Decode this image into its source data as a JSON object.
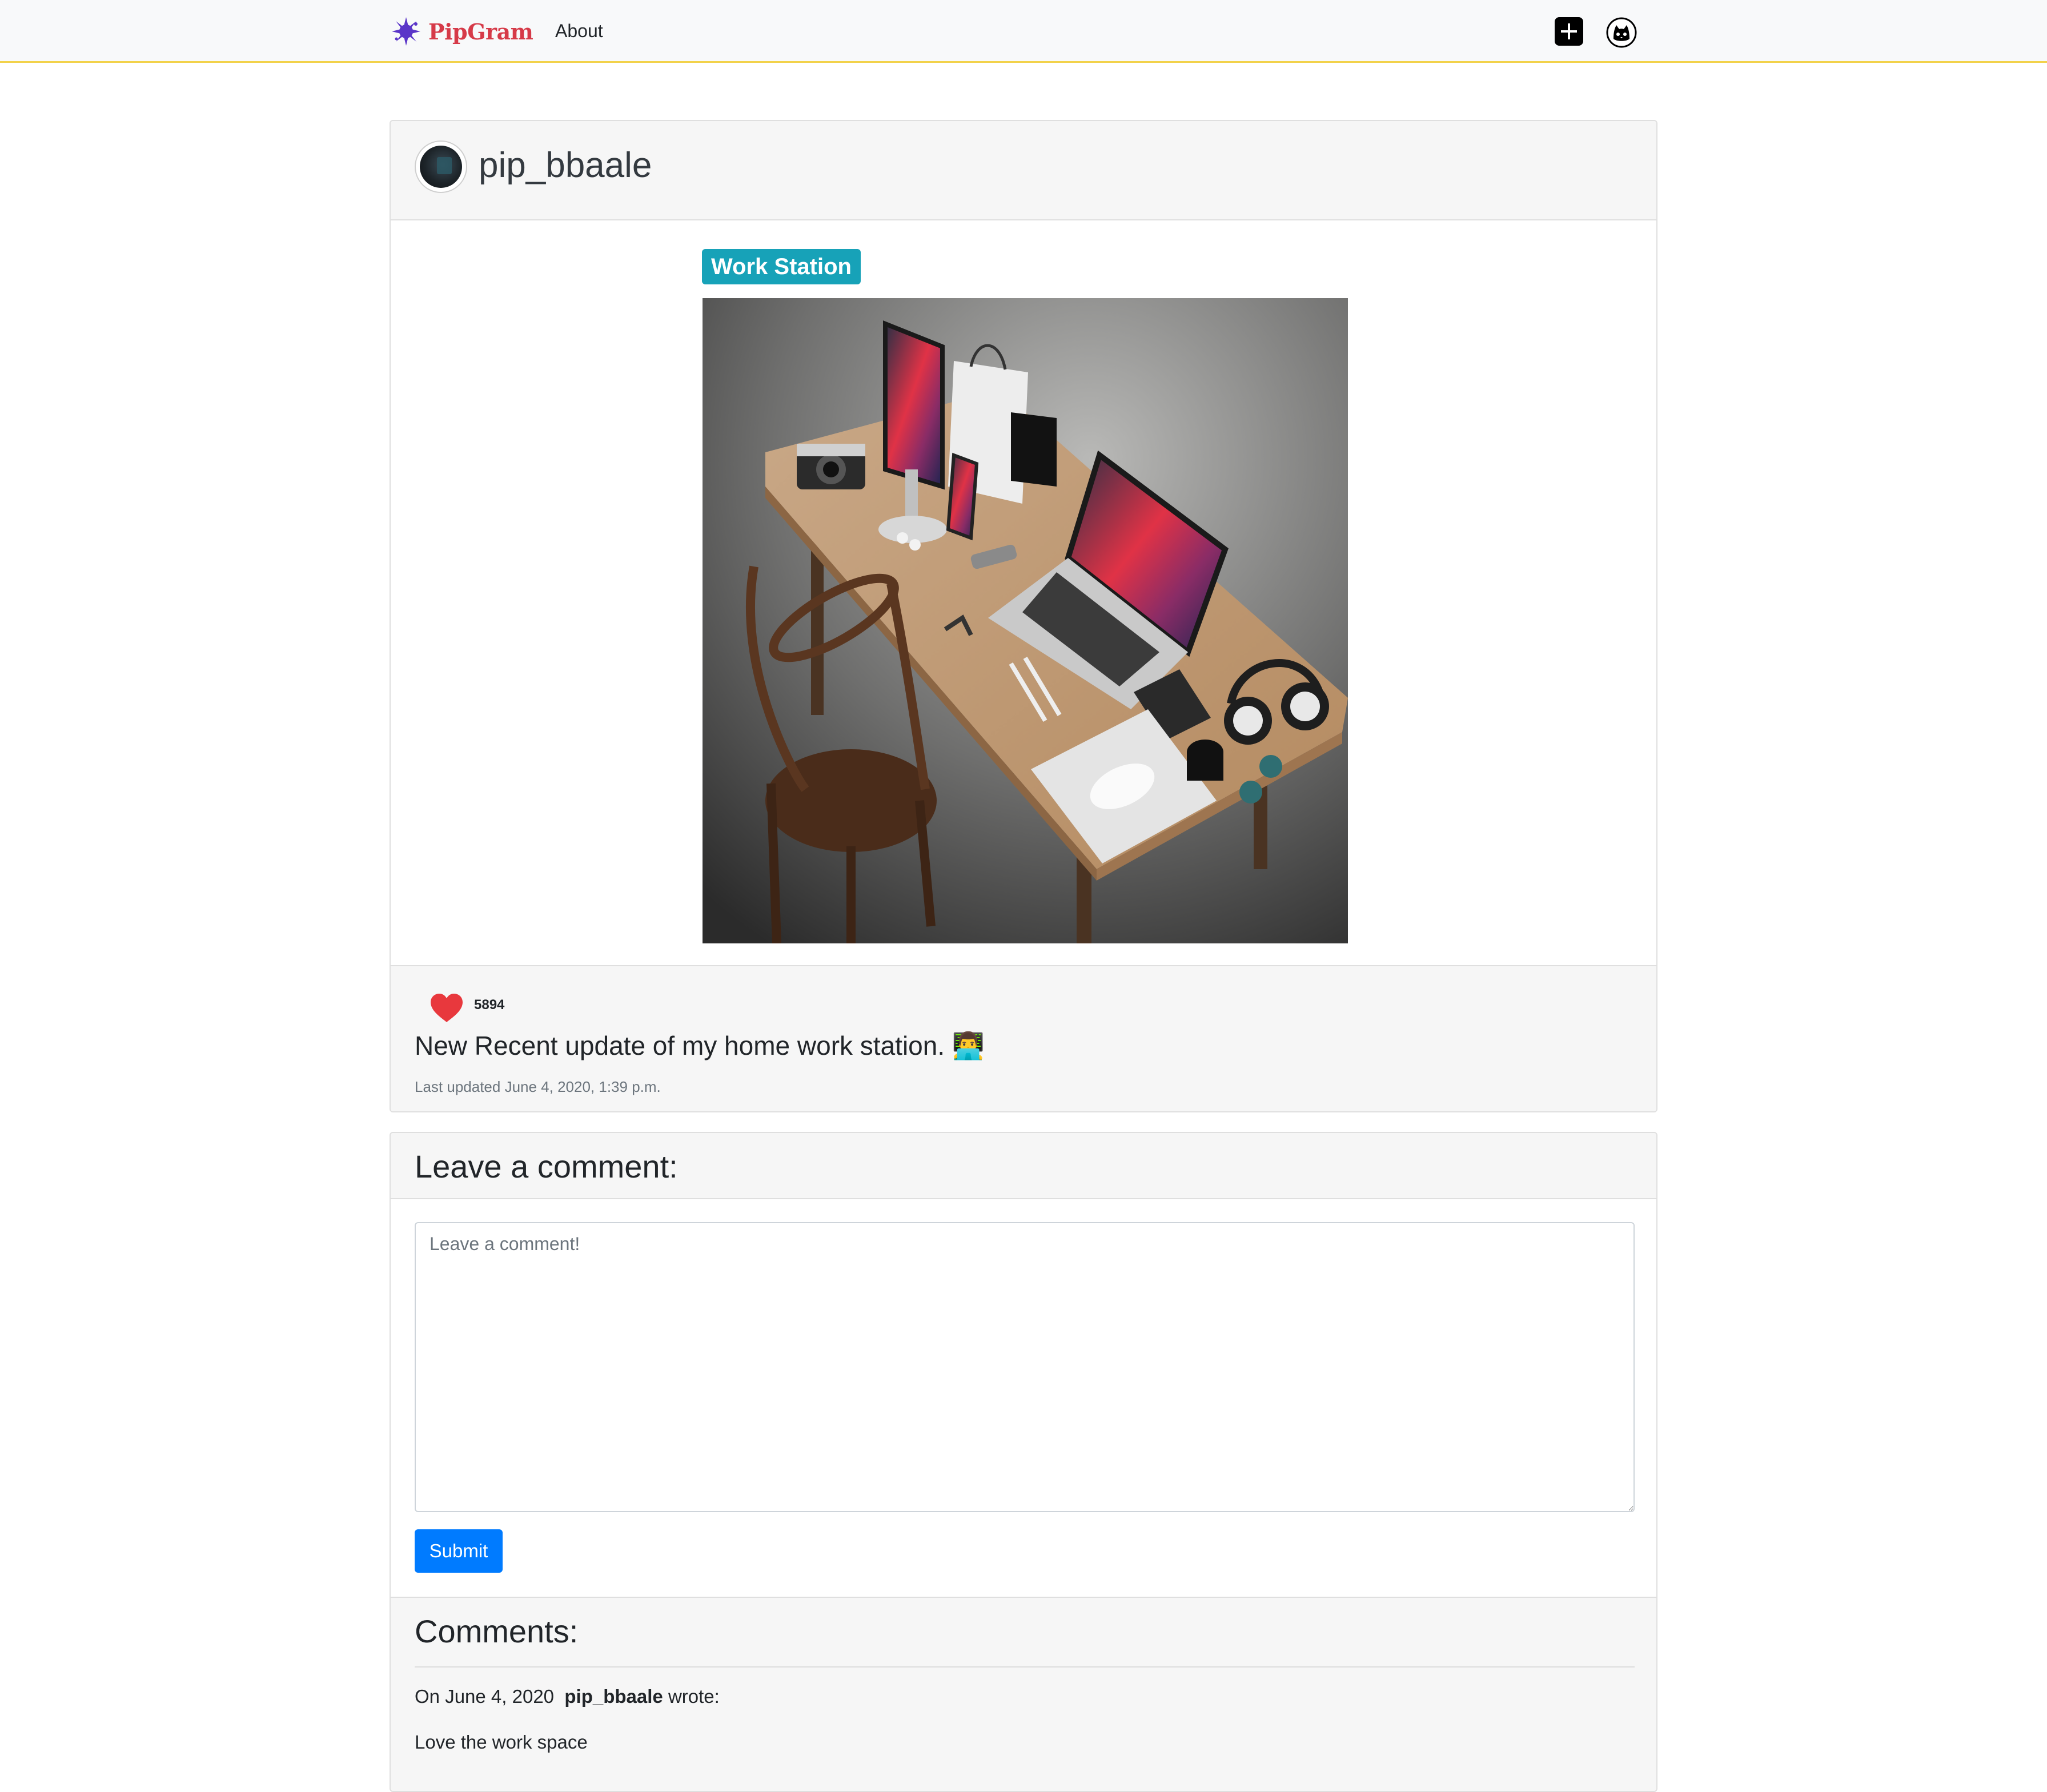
{
  "navbar": {
    "brand": "PipGram",
    "about_label": "About",
    "add_icon": "plus-square-icon",
    "profile_icon": "cat-avatar-icon",
    "brand_color": "#d63a48",
    "logo_color": "#5a35c8"
  },
  "post": {
    "username": "pip_bbaale",
    "tag": "Work Station",
    "tag_color": "#17a2b8",
    "image_icon": "workstation-photo",
    "likes": "5894",
    "like_icon": "heart-icon",
    "caption": "New Recent update of my home work station. 👨‍💻",
    "last_updated": "Last updated June 4, 2020, 1:39 p.m."
  },
  "comment_form": {
    "title": "Leave a comment:",
    "placeholder": "Leave a comment!",
    "value": "",
    "submit_label": "Submit",
    "submit_color": "#007bff"
  },
  "comments": {
    "title": "Comments:",
    "items": [
      {
        "date_prefix": "On June 4, 2020",
        "author": "pip_bbaale",
        "wrote": "wrote:",
        "text": "Love the work space"
      }
    ]
  }
}
